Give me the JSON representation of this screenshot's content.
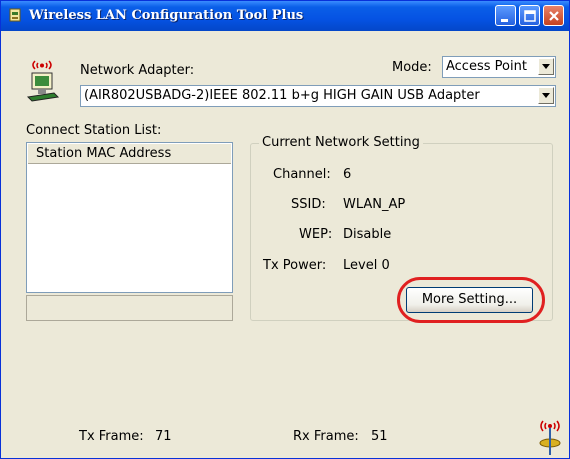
{
  "window": {
    "title": "Wireless LAN Configuration Tool Plus"
  },
  "adapter": {
    "label": "Network Adapter:",
    "value": "(AIR802USBADG-2)IEEE 802.11 b+g HIGH GAIN USB Adapter"
  },
  "mode": {
    "label": "Mode:",
    "value": "Access Point"
  },
  "station_list": {
    "label": "Connect Station List:",
    "column_header": "Station MAC Address"
  },
  "network_setting": {
    "title": "Current Network Setting",
    "channel_label": "Channel:",
    "channel_value": "6",
    "ssid_label": "SSID:",
    "ssid_value": "WLAN_AP",
    "wep_label": "WEP:",
    "wep_value": "Disable",
    "txpower_label": "Tx Power:",
    "txpower_value": "Level 0",
    "more_button": "More Setting..."
  },
  "status": {
    "tx_frame_label": "Tx Frame:",
    "tx_frame_value": "71",
    "rx_frame_label": "Rx Frame:",
    "rx_frame_value": "51"
  },
  "colors": {
    "title_bar": "#0553E3",
    "window_bg": "#ECE9D8",
    "highlight": "#E02020"
  }
}
